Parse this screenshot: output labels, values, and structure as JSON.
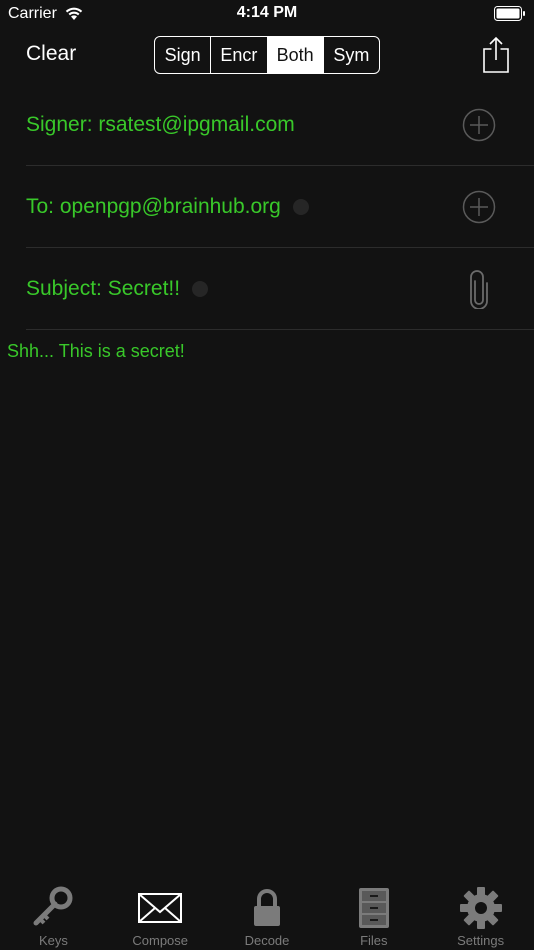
{
  "status_bar": {
    "carrier": "Carrier",
    "time": "4:14 PM"
  },
  "nav": {
    "clear_label": "Clear",
    "segments": [
      "Sign",
      "Encr",
      "Both",
      "Sym"
    ],
    "selected_segment": "Both"
  },
  "form": {
    "signer": "Signer: rsatest@ipgmail.com",
    "to": "To: openpgp@brainhub.org",
    "subject": "Subject: Secret!!",
    "body": "Shh... This is a secret!"
  },
  "tabs": [
    {
      "label": "Keys",
      "icon": "key-icon"
    },
    {
      "label": "Compose",
      "icon": "envelope-icon"
    },
    {
      "label": "Decode",
      "icon": "lock-icon"
    },
    {
      "label": "Files",
      "icon": "file-cabinet-icon"
    },
    {
      "label": "Settings",
      "icon": "gear-icon"
    }
  ],
  "colors": {
    "background": "#121212",
    "accent_green": "#39c82a",
    "icon_gray": "#7b7b7b"
  }
}
